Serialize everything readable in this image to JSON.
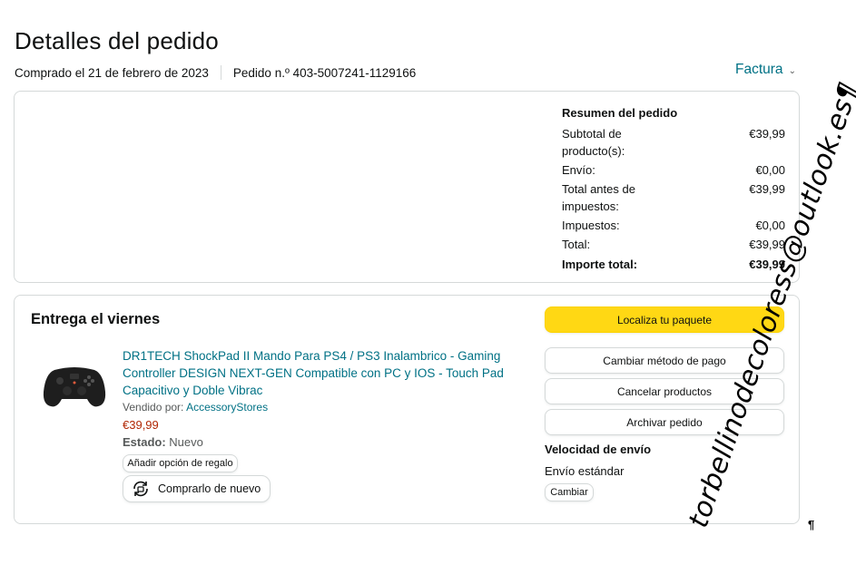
{
  "page": {
    "title": "Detalles del pedido",
    "purchased": "Comprado el 21 de febrero de 2023",
    "order_number": "Pedido n.º 403-5007241-1129166",
    "invoice_label": "Factura"
  },
  "summary": {
    "heading": "Resumen del pedido",
    "rows": [
      {
        "label": "Subtotal de producto(s):",
        "value": "€39,99"
      },
      {
        "label": "Envío:",
        "value": "€0,00"
      },
      {
        "label": "Total antes de impuestos:",
        "value": "€39,99"
      },
      {
        "label": "Impuestos:",
        "value": "€0,00"
      },
      {
        "label": "Total:",
        "value": "€39,99"
      },
      {
        "label": "Importe total:",
        "value": "€39,99"
      }
    ]
  },
  "delivery": {
    "title": "Entrega el viernes",
    "product_title": "DR1TECH ShockPad II Mando Para PS4 / PS3 Inalambrico - Gaming Controller DESIGN NEXT-GEN Compatible con PC y IOS - Touch Pad Capacitivo y Doble Vibrac",
    "sold_by_label": "Vendido por:",
    "seller": "AccessoryStores",
    "price": "€39,99",
    "condition_label": "Estado:",
    "condition": "Nuevo",
    "gift_button": "Añadir opción de regalo",
    "buy_again_button": "Comprarlo de nuevo"
  },
  "actions": {
    "track": "Localiza tu paquete",
    "change_payment": "Cambiar método de pago",
    "cancel": "Cancelar productos",
    "archive": "Archivar pedido"
  },
  "shipping": {
    "title": "Velocidad de envío",
    "value": "Envío estándar",
    "change_button": "Cambiar"
  },
  "overlay": {
    "watermark": "torbellinodecoloress@outlook.es¶",
    "pilcrow": "¶"
  },
  "colors": {
    "link": "#007185",
    "price": "#b12704",
    "primary_button": "#ffd814",
    "border": "#d5d9d9"
  }
}
